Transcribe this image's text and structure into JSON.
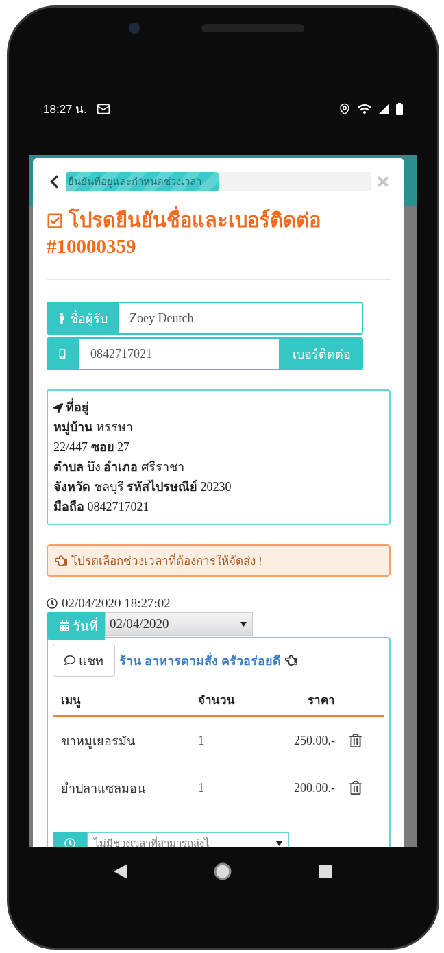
{
  "status_bar": {
    "time": "18:27 น."
  },
  "progress": {
    "label": "ยืนยันที่อยู่และกำหนดช่วงเวลา",
    "level": 0.5
  },
  "heading": {
    "title": "โปรดยืนยันชื่อและเบอร์ติดต่อ",
    "order_number": "#10000359"
  },
  "recipient": {
    "label": "ชื่อผู้รับ",
    "value": "Zoey Deutch"
  },
  "phone": {
    "value": "0842717021",
    "button": "เบอร์ติดต่อ"
  },
  "address": {
    "title": "ที่อยู่",
    "lines": [
      "**หมู่บ้าน** หรรษา",
      "22/447 **ซอย** 27",
      "**ตำบล** บึง **อำเภอ** ศรีราชา",
      "**จังหวัด** ชลบุรี **รหัสไปรษณีย์** 20230",
      "**มือถือ** 0842717021"
    ]
  },
  "alert": "โปรดเลือกช่วงเวลาที่ต้องการให้จัดส่ง !",
  "timestamp": "02/04/2020 18:27:02",
  "date": {
    "label": "วันที่",
    "value": "02/04/2020"
  },
  "shop": {
    "chat_button": "แชท",
    "name": "ร้าน อาหารตามสั่ง ครัวอร่อยดี"
  },
  "table": {
    "columns": [
      "เมนู",
      "จำนวน",
      "ราคา"
    ],
    "rows": [
      {
        "menu": "ขาหมูเยอรมัน",
        "qty": "1",
        "price": "250.00.-"
      },
      {
        "menu": "ยำปลาแซลมอน",
        "qty": "1",
        "price": "200.00.-"
      }
    ]
  },
  "time_slot": {
    "placeholder": "ไม่มีช่วงเวลาที่สามารถส่งไ"
  }
}
